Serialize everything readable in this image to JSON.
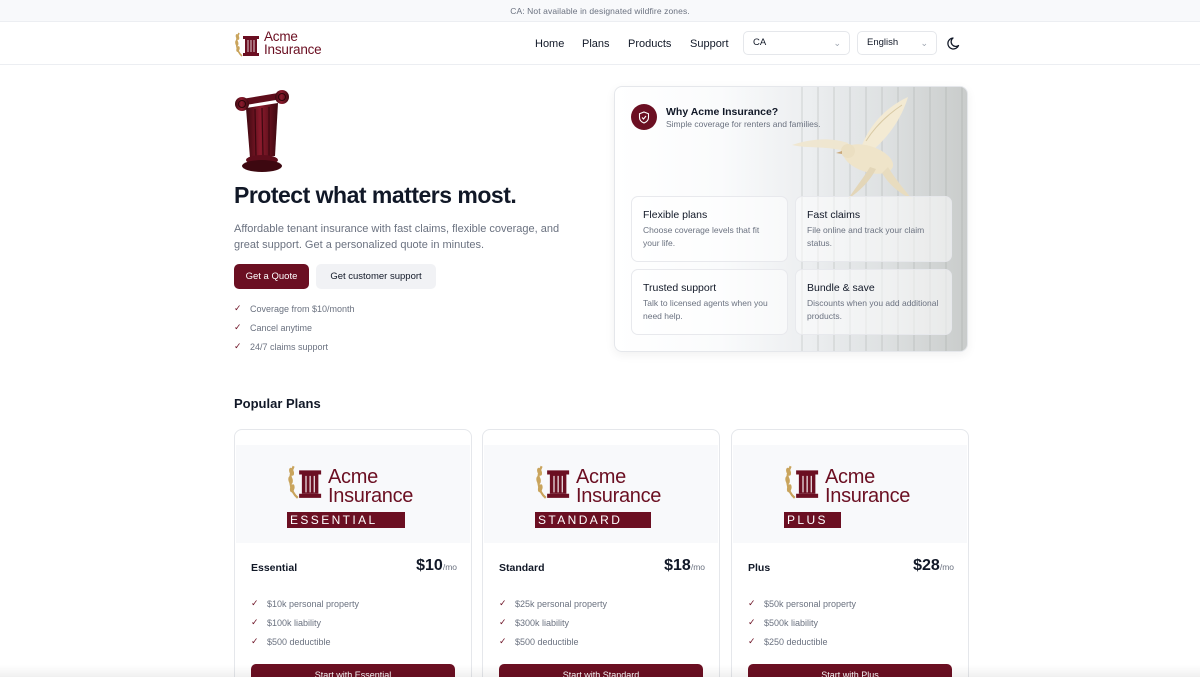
{
  "banner": {
    "text": "CA: Not available in designated wildfire zones."
  },
  "header": {
    "logo_line1": "Acme",
    "logo_line2": "Insurance",
    "nav": [
      "Home",
      "Plans",
      "Products",
      "Support"
    ],
    "state_select": "CA",
    "language_select": "English"
  },
  "hero": {
    "headline": "Protect what matters most.",
    "subtitle": "Affordable tenant insurance with fast claims, flexible coverage, and great support. Get a personalized quote in minutes.",
    "primary_cta": "Get a Quote",
    "secondary_cta": "Get customer support",
    "checks": [
      "Coverage from $10/month",
      "Cancel anytime",
      "24/7 claims support"
    ]
  },
  "why": {
    "title": "Why Acme Insurance?",
    "subtitle": "Simple coverage for renters and families.",
    "features": [
      {
        "title": "Flexible plans",
        "desc": "Choose coverage levels that fit your life."
      },
      {
        "title": "Fast claims",
        "desc": "File online and track your claim status."
      },
      {
        "title": "Trusted support",
        "desc": "Talk to licensed agents when you need help."
      },
      {
        "title": "Bundle & save",
        "desc": "Discounts when you add additional products."
      }
    ]
  },
  "plans_section": {
    "title": "Popular Plans",
    "plans": [
      {
        "logo_line1": "Acme",
        "logo_line2": "Insurance",
        "tier": "ESSENTIAL",
        "name": "Essential",
        "price": "$10",
        "unit": "/mo",
        "features": [
          "$10k personal property",
          "$100k liability",
          "$500 deductible"
        ],
        "cta": "Start with Essential"
      },
      {
        "logo_line1": "Acme",
        "logo_line2": "Insurance",
        "tier": "STANDARD",
        "name": "Standard",
        "price": "$18",
        "unit": "/mo",
        "features": [
          "$25k personal property",
          "$300k liability",
          "$500 deductible"
        ],
        "cta": "Start with Standard"
      },
      {
        "logo_line1": "Acme",
        "logo_line2": "Insurance",
        "tier": "PLUS",
        "name": "Plus",
        "price": "$28",
        "unit": "/mo",
        "features": [
          "$50k personal property",
          "$500k liability",
          "$250 deductible"
        ],
        "cta": "Start with Plus"
      }
    ]
  },
  "colors": {
    "brand": "#6b0f22",
    "text": "#111827",
    "muted": "#6b7280",
    "border": "#e5e7eb"
  },
  "icons": [
    "laurel-icon",
    "pillar-icon",
    "chevron-down-icon",
    "moon-icon",
    "check-icon",
    "shield-icon",
    "dove-image"
  ]
}
